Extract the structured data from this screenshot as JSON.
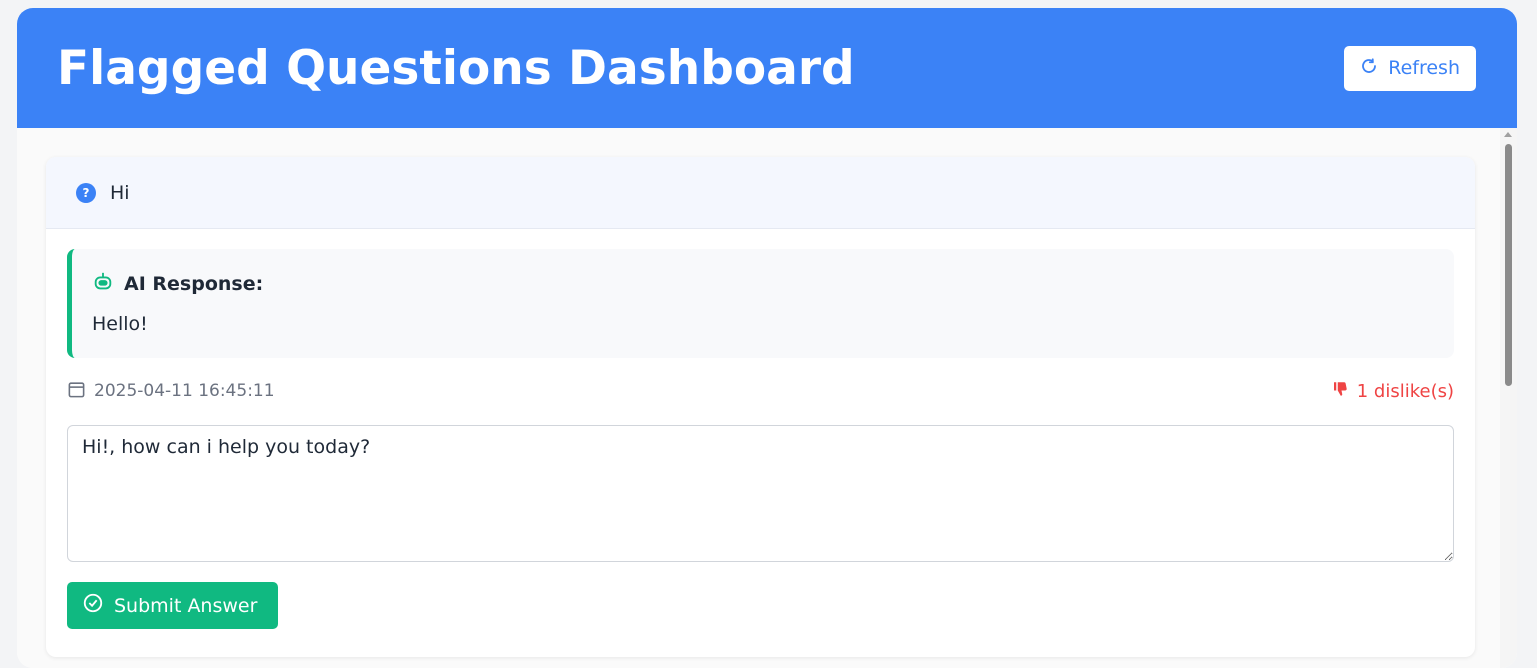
{
  "header": {
    "title": "Flagged Questions Dashboard",
    "refresh_label": "Refresh"
  },
  "question": {
    "icon": "question-circle-icon",
    "text": "Hi"
  },
  "ai_response": {
    "icon": "robot-icon",
    "label": "AI Response:",
    "text": "Hello!"
  },
  "meta": {
    "date_icon": "calendar-icon",
    "timestamp": "2025-04-11 16:45:11",
    "dislike_icon": "thumbs-down-icon",
    "dislikes": "1 dislike(s)"
  },
  "answer": {
    "value": "Hi!, how can i help you today?"
  },
  "submit": {
    "icon": "check-circle-icon",
    "label": "Submit Answer"
  },
  "colors": {
    "header": "#3b82f6",
    "accent_green": "#10b981",
    "dislike_red": "#ef4444"
  }
}
